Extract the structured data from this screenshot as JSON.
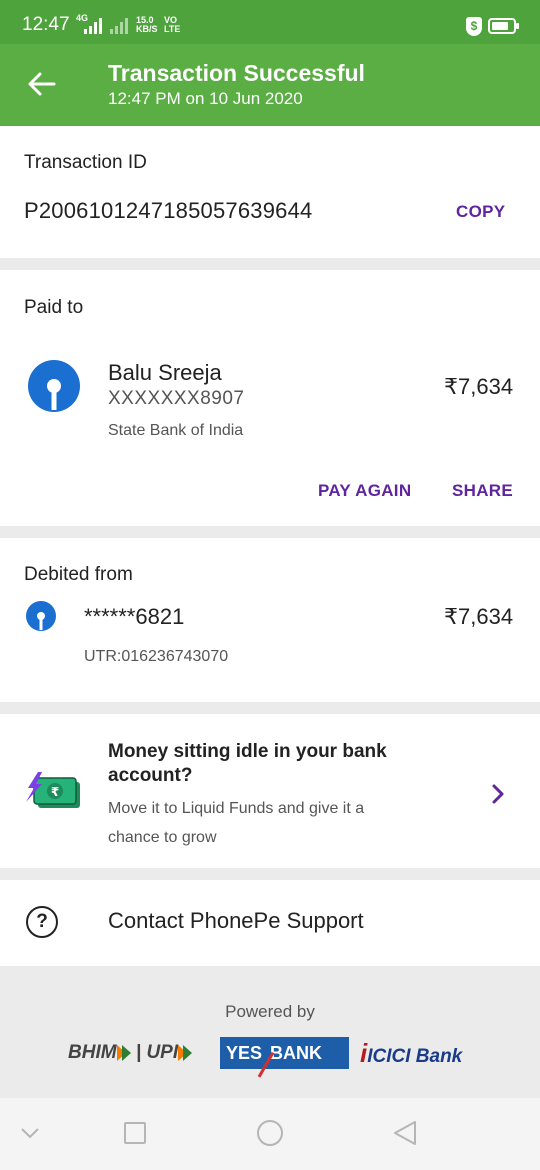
{
  "status_bar": {
    "time": "12:47",
    "network_label": "4G",
    "speed": "15.0",
    "speed_unit": "KB/S",
    "volte_top": "VO",
    "volte_bottom": "LTE",
    "shield_symbol": "$"
  },
  "header": {
    "title": "Transaction Successful",
    "subtitle": "12:47 PM on 10 Jun 2020",
    "back_icon": "arrow-left-icon",
    "background": "#5aae43",
    "status_background": "#4fa33c"
  },
  "transaction": {
    "label": "Transaction ID",
    "id": "P2006101247185057639644",
    "copy_label": "COPY"
  },
  "paid_to": {
    "label": "Paid to",
    "name": "Balu Sreeja",
    "account": "XXXXXXX8907",
    "bank": "State Bank of India",
    "amount": "₹7,634",
    "pay_again_label": "PAY AGAIN",
    "share_label": "SHARE"
  },
  "debited_from": {
    "label": "Debited from",
    "account": "******6821",
    "amount": "₹7,634",
    "utr": "UTR:016236743070"
  },
  "promo": {
    "title": "Money sitting idle in your bank account?",
    "description": "Move it to Liquid Funds and give it a chance to grow",
    "icon": "money-bolt-icon"
  },
  "support": {
    "label": "Contact PhonePe Support",
    "icon": "help-circle-icon"
  },
  "footer": {
    "powered_by": "Powered by",
    "bhim_text": "BHIM",
    "upi_text": "UPI",
    "yes_text": "YES",
    "bank_text": "BANK",
    "icici_i": "i",
    "icici_text": "ICICI Bank"
  },
  "colors": {
    "accent_purple": "#5f259f",
    "sbi_blue": "#1a6fd1",
    "yes_blue": "#1e5ea8"
  }
}
